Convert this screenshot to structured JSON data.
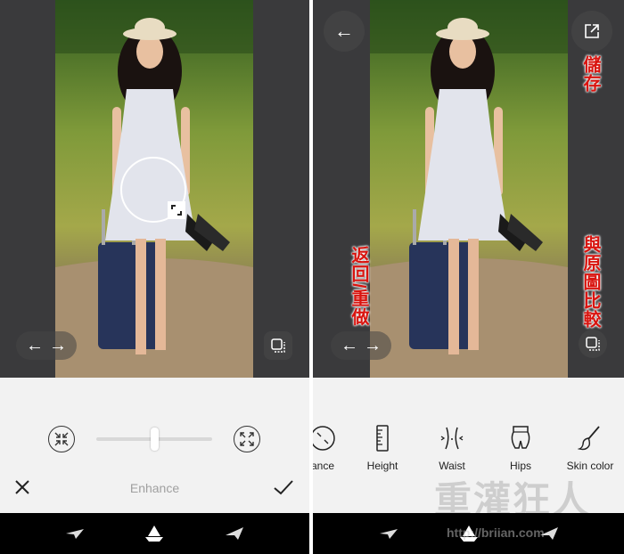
{
  "left_screen": {
    "arrows": [
      "←",
      "→"
    ],
    "mode_label": "Enhance"
  },
  "right_screen": {
    "annotations": {
      "save": "儲存",
      "undo_redo": "返回/重做",
      "compare": "與原圖比較"
    },
    "tools": [
      {
        "label": "ance",
        "icon": "enhance-icon"
      },
      {
        "label": "Height",
        "icon": "ruler-icon"
      },
      {
        "label": "Waist",
        "icon": "waist-icon"
      },
      {
        "label": "Hips",
        "icon": "hips-icon"
      },
      {
        "label": "Skin color",
        "icon": "brush-icon"
      }
    ],
    "arrows": [
      "←",
      "→"
    ]
  },
  "watermark": {
    "logo_text": "重灌狂人",
    "url": "http://briian.com"
  },
  "colors": {
    "annotation": "#d9140f",
    "nav_background": "#000000",
    "panel_background": "#f2f2f2",
    "photo_frame": "#3a3a3c"
  }
}
